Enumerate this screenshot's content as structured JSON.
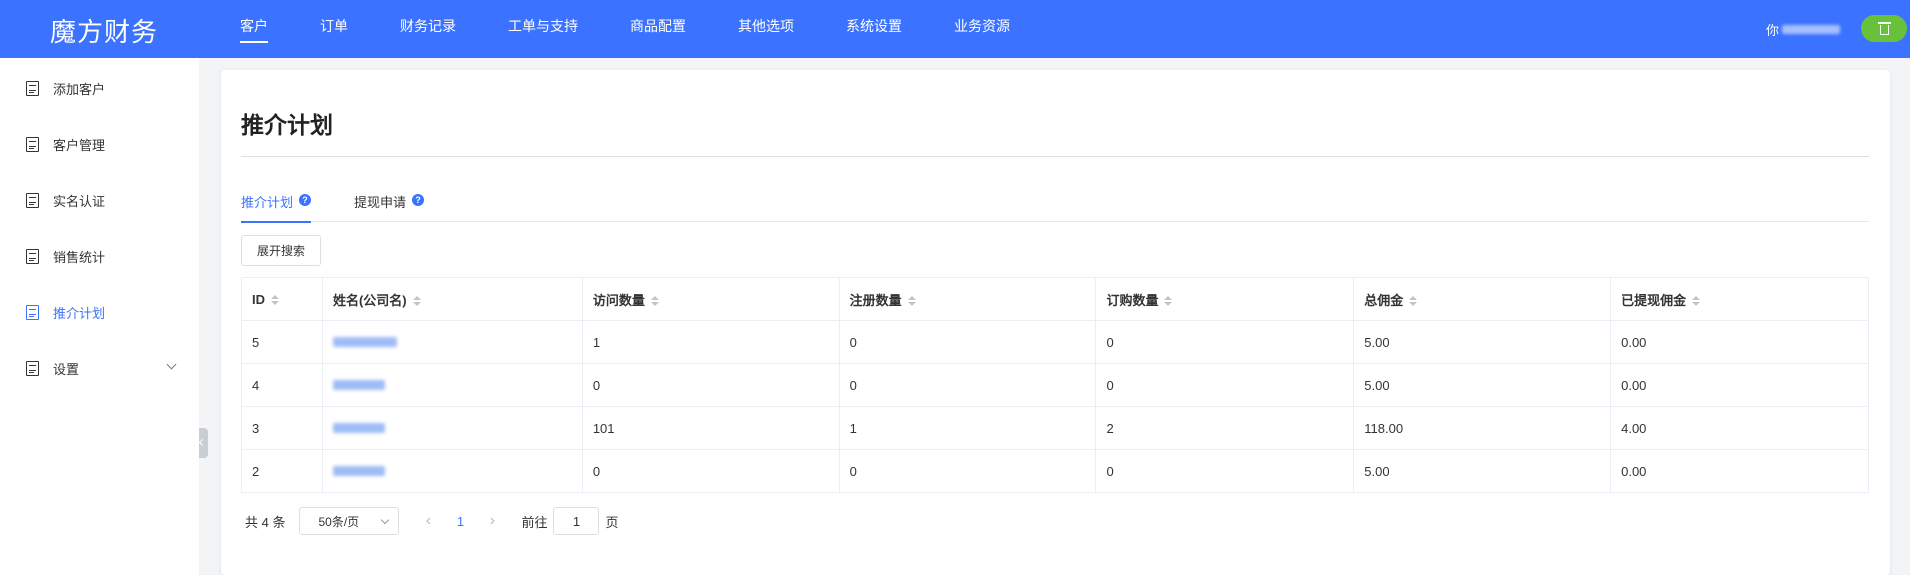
{
  "app": {
    "brand": "魔方财务"
  },
  "nav": {
    "items": [
      "客户",
      "订单",
      "财务记录",
      "工单与支持",
      "商品配置",
      "其他选项",
      "系统设置",
      "业务资源"
    ],
    "active": "客户"
  },
  "user": {
    "name_prefix": "你"
  },
  "sidebar": {
    "items": [
      {
        "label": "添加客户",
        "icon": "document-icon"
      },
      {
        "label": "客户管理",
        "icon": "document-icon"
      },
      {
        "label": "实名认证",
        "icon": "document-icon"
      },
      {
        "label": "销售统计",
        "icon": "document-icon"
      },
      {
        "label": "推介计划",
        "icon": "document-icon",
        "active": true
      },
      {
        "label": "设置",
        "icon": "document-icon",
        "expandable": true
      }
    ]
  },
  "page": {
    "title": "推介计划"
  },
  "tabs": [
    {
      "label": "推介计划",
      "active": true
    },
    {
      "label": "提现申请",
      "active": false
    }
  ],
  "toolbar": {
    "search_toggle": "展开搜索"
  },
  "table": {
    "columns": [
      "ID",
      "姓名(公司名)",
      "访问数量",
      "注册数量",
      "订购数量",
      "总佣金",
      "已提现佣金"
    ],
    "rows": [
      {
        "id": "5",
        "name": "",
        "visits": "1",
        "registrations": "0",
        "orders": "0",
        "commission": "5.00",
        "withdrawn": "0.00"
      },
      {
        "id": "4",
        "name": "",
        "visits": "0",
        "registrations": "0",
        "orders": "0",
        "commission": "5.00",
        "withdrawn": "0.00"
      },
      {
        "id": "3",
        "name": "",
        "visits": "101",
        "registrations": "1",
        "orders": "2",
        "commission": "118.00",
        "withdrawn": "4.00"
      },
      {
        "id": "2",
        "name": "",
        "visits": "0",
        "registrations": "0",
        "orders": "0",
        "commission": "5.00",
        "withdrawn": "0.00"
      }
    ]
  },
  "pagination": {
    "total": "共 4 条",
    "page_size": "50条/页",
    "current_page": "1",
    "goto_prefix": "前往",
    "goto_value": "1",
    "goto_suffix": "页"
  },
  "colors": {
    "primary": "#3b72ff",
    "logout": "#67c23a"
  }
}
